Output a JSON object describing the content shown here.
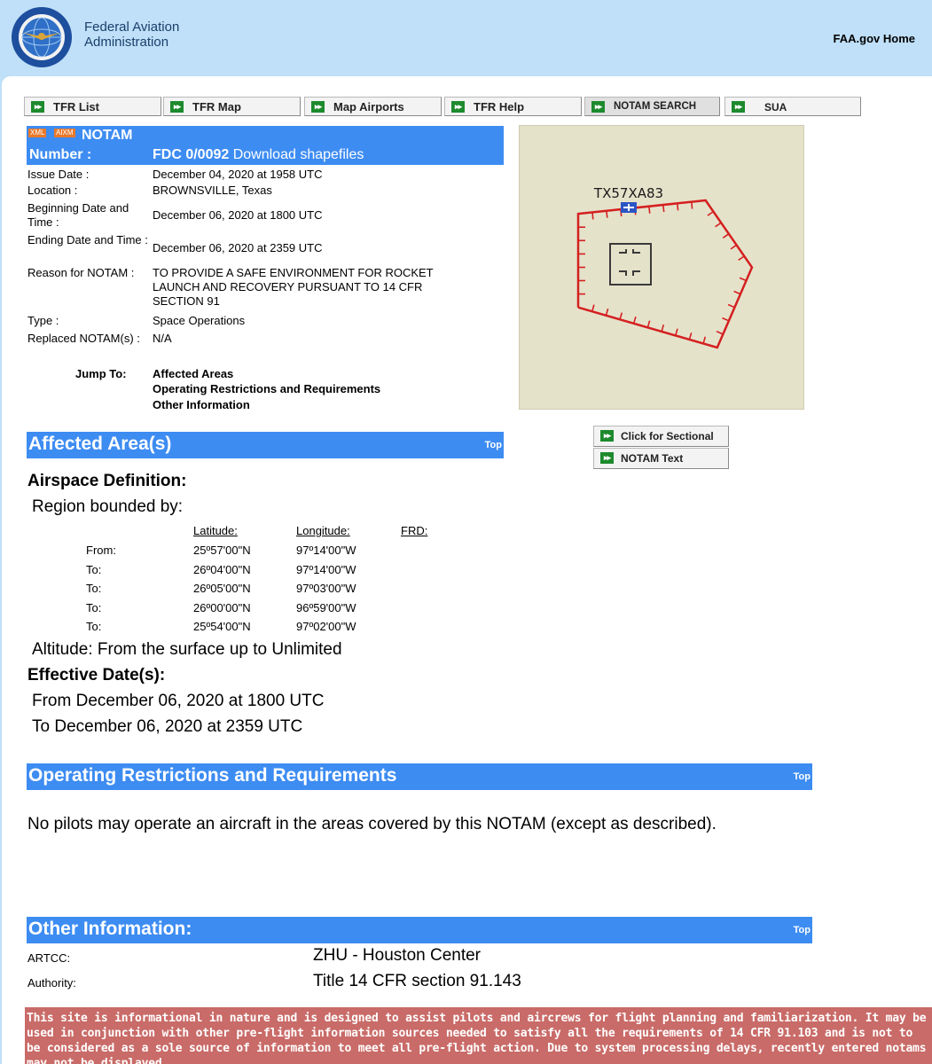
{
  "header": {
    "agency_line1": "Federal Aviation",
    "agency_line2": "Administration",
    "home_link": "FAA.gov Home",
    "seal_icon": "faa-seal-icon"
  },
  "nav": {
    "arrow_glyph": "▸▸",
    "items": [
      {
        "label": "TFR List"
      },
      {
        "label": "TFR Map"
      },
      {
        "label": "Map Airports"
      },
      {
        "label": "TFR Help"
      },
      {
        "label": "NOTAM SEARCH"
      },
      {
        "label": "SUA"
      }
    ]
  },
  "notam": {
    "badge_xml": "XML",
    "badge_aixm": "AIXM",
    "title": "NOTAM",
    "number_label": "Number :",
    "number": "FDC 0/0092",
    "download": "Download shapefiles",
    "fields": [
      {
        "label": "Issue Date :",
        "value": "December 04, 2020 at 1958 UTC"
      },
      {
        "label": "Location :",
        "value": "BROWNSVILLE, Texas"
      },
      {
        "label": "Beginning Date and Time :",
        "value": "December 06, 2020 at 1800 UTC"
      },
      {
        "label": "Ending Date and Time :",
        "value": "December 06, 2020 at 2359 UTC"
      },
      {
        "label": "Reason for NOTAM :",
        "value": "TO PROVIDE A SAFE ENVIRONMENT FOR ROCKET LAUNCH AND RECOVERY PURSUANT TO 14 CFR SECTION 91"
      },
      {
        "label": "Type :",
        "value": "Space Operations"
      },
      {
        "label": "Replaced NOTAM(s) :",
        "value": "N/A"
      }
    ],
    "jump_label": "Jump To:",
    "jump_links": [
      "Affected Areas",
      "Operating Restrictions and Requirements",
      "Other Information"
    ]
  },
  "map": {
    "airport_label": "TX57XA83",
    "sectional_button": "Click for Sectional",
    "notam_text_button": "NOTAM Text"
  },
  "affected": {
    "title": "Affected Area(s)",
    "top": "Top",
    "airspace_heading": "Airspace Definition:",
    "region_text": "Region bounded by:",
    "col_lat": "Latitude:",
    "col_lon": "Longitude:",
    "col_frd": "FRD:",
    "points": [
      {
        "label": "From:",
        "lat": "25º57'00\"N",
        "lon": "97º14'00\"W"
      },
      {
        "label": "To:",
        "lat": "26º04'00\"N",
        "lon": "97º14'00\"W"
      },
      {
        "label": "To:",
        "lat": "26º05'00\"N",
        "lon": "97º03'00\"W"
      },
      {
        "label": "To:",
        "lat": "26º00'00\"N",
        "lon": "96º59'00\"W"
      },
      {
        "label": "To:",
        "lat": "25º54'00\"N",
        "lon": "97º02'00\"W"
      }
    ],
    "altitude": "Altitude: From the surface up to Unlimited",
    "effective_heading": "Effective Date(s):",
    "from_date": "From December 06, 2020 at 1800 UTC",
    "to_date": "To December 06, 2020 at 2359 UTC"
  },
  "restrictions": {
    "title": "Operating Restrictions and Requirements",
    "top": "Top",
    "text": "No pilots may operate an aircraft in the areas covered by this NOTAM (except as described)."
  },
  "other": {
    "title": "Other Information:",
    "top": "Top",
    "artcc_label": "ARTCC:",
    "artcc_value": "ZHU - Houston Center",
    "authority_label": "Authority:",
    "authority_value": "Title 14 CFR section 91.143"
  },
  "disclaimer": "This site is informational in nature and is designed to assist pilots and aircrews for flight planning and familiarization. It may be used in conjunction with other pre-flight information sources needed to satisfy all the requirements of 14 CFR 91.103 and is not to be considered as a sole source of information to meet all pre-flight action. Due to system processing delays, recently entered notams may not be displayed"
}
